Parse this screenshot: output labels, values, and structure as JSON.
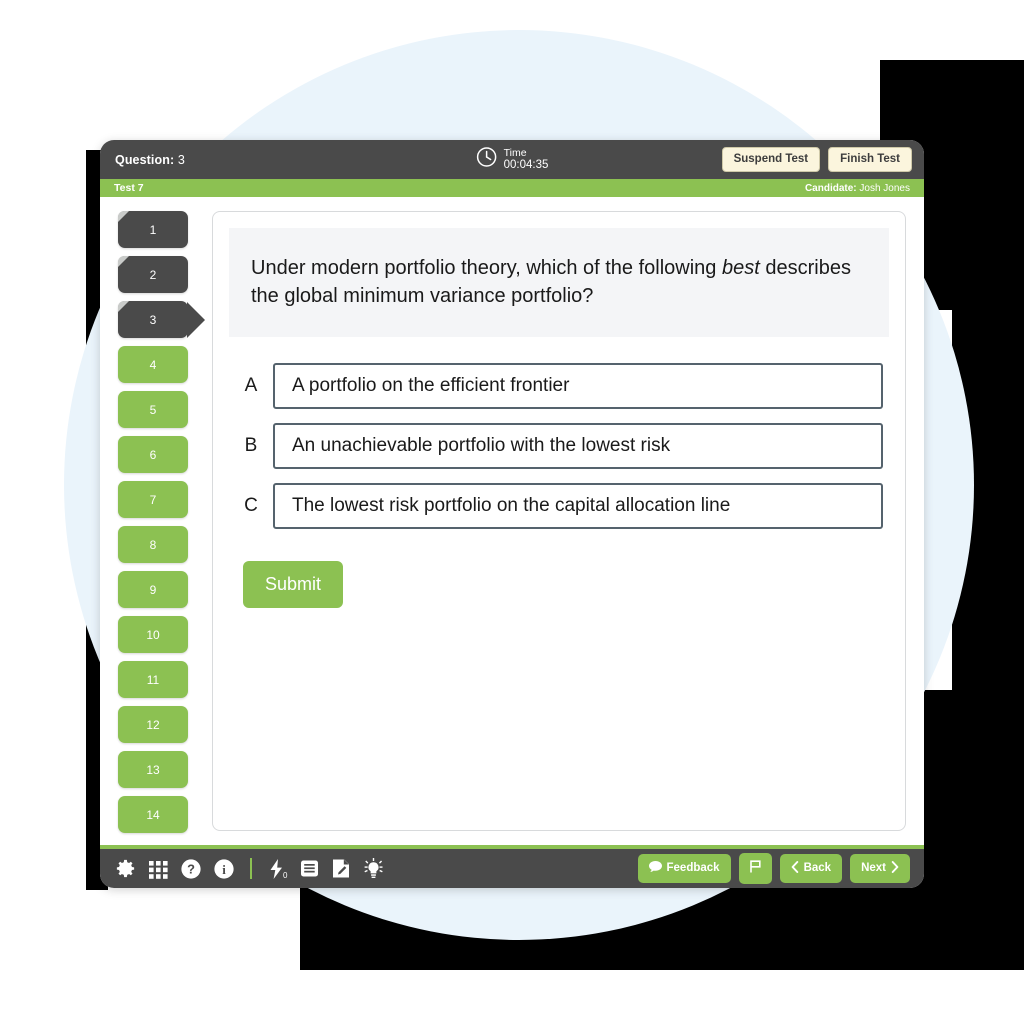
{
  "backdrop": {
    "circle_color": "#eaf4fb",
    "shadow_color": "#000000",
    "page_background": "#ffffff"
  },
  "theme": {
    "accent_green": "#8cc152",
    "dark_bar": "#4a4a4a",
    "cream_button": "#fbf5dd",
    "option_border": "#55636d",
    "stem_background": "#f4f5f7"
  },
  "header": {
    "question_label": "Question:",
    "question_number": "3",
    "timer": {
      "icon": "clock-icon",
      "label": "Time",
      "value": "00:04:35"
    },
    "buttons": [
      {
        "label": "Suspend Test",
        "name": "suspend-test-button"
      },
      {
        "label": "Finish Test",
        "name": "finish-test-button"
      }
    ]
  },
  "subheader": {
    "test_name": "Test 7",
    "candidate_label": "Candidate:",
    "candidate_name": "Josh Jones"
  },
  "nav_rail": {
    "items": [
      {
        "number": "1",
        "state": "answered"
      },
      {
        "number": "2",
        "state": "answered"
      },
      {
        "number": "3",
        "state": "current"
      },
      {
        "number": "4",
        "state": "unanswered"
      },
      {
        "number": "5",
        "state": "unanswered"
      },
      {
        "number": "6",
        "state": "unanswered"
      },
      {
        "number": "7",
        "state": "unanswered"
      },
      {
        "number": "8",
        "state": "unanswered"
      },
      {
        "number": "9",
        "state": "unanswered"
      },
      {
        "number": "10",
        "state": "unanswered"
      },
      {
        "number": "11",
        "state": "unanswered"
      },
      {
        "number": "12",
        "state": "unanswered"
      },
      {
        "number": "13",
        "state": "unanswered"
      },
      {
        "number": "14",
        "state": "unanswered"
      }
    ]
  },
  "question": {
    "stem_part1": "Under modern portfolio theory, which of the following ",
    "stem_emphasis": "best",
    "stem_part2": " describes the global minimum variance portfolio?",
    "options": [
      {
        "letter": "A",
        "text": "A portfolio on the efficient frontier"
      },
      {
        "letter": "B",
        "text": "An unachievable portfolio with the lowest risk"
      },
      {
        "letter": "C",
        "text": "The lowest risk portfolio on the capital allocation line"
      }
    ],
    "submit_label": "Submit"
  },
  "footer": {
    "tools": [
      {
        "name": "settings-gear-icon",
        "title": "Settings"
      },
      {
        "name": "grid-icon",
        "title": "Question grid"
      },
      {
        "name": "help-question-icon",
        "title": "Help"
      },
      {
        "name": "info-icon",
        "title": "Information"
      },
      {
        "name": "lightning-bolt-icon",
        "title": "Flashcards",
        "badge": "0"
      },
      {
        "name": "book-icon",
        "title": "Notes"
      },
      {
        "name": "document-pencil-icon",
        "title": "Scratchpad"
      },
      {
        "name": "lightbulb-icon",
        "title": "Hint"
      }
    ],
    "buttons": [
      {
        "name": "feedback-button",
        "label": "Feedback",
        "icon": "speech-bubble-icon"
      },
      {
        "name": "flag-button",
        "label": "",
        "icon": "flag-icon"
      },
      {
        "name": "back-button",
        "label": "Back",
        "icon": "chevron-left-icon"
      },
      {
        "name": "next-button",
        "label": "Next",
        "icon": "chevron-right-icon"
      }
    ]
  }
}
